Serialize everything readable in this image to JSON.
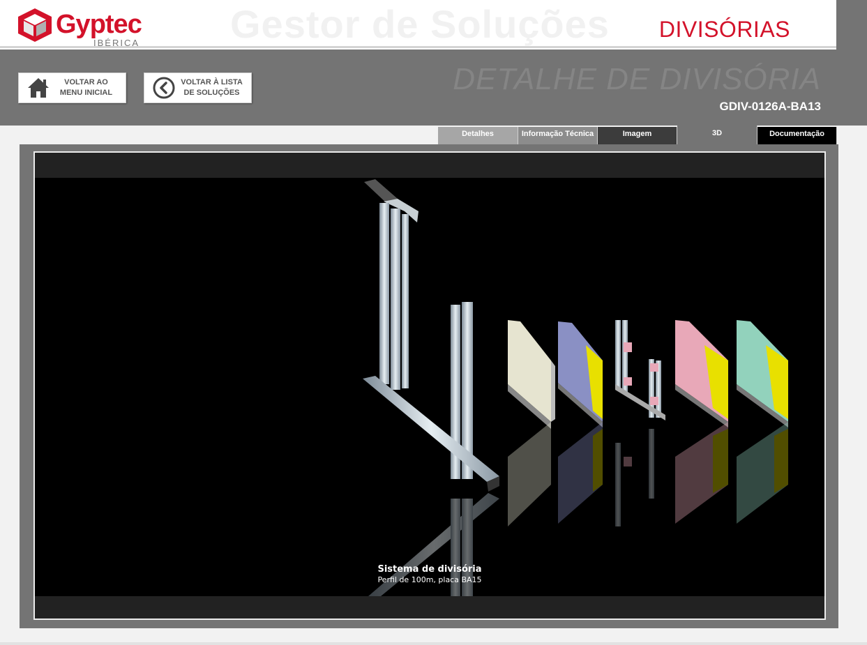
{
  "header": {
    "logo_word_1": "Gyp",
    "logo_word_2": "tec",
    "logo_sub": "IBÉRICA",
    "app_title": "Gestor de Soluções",
    "section_title": "DIVISÓRIAS"
  },
  "nav": {
    "home_line1": "VOLTAR AO",
    "home_line2": "MENU INICIAL",
    "back_line1": "VOLTAR À LISTA",
    "back_line2": "DE SOLUÇÕES"
  },
  "detail": {
    "title": "DETALHE DE DIVISÓRIA",
    "code": "GDIV-0126A-BA13"
  },
  "tabs": [
    {
      "label": "Detalhes"
    },
    {
      "label": "Informação Técnica"
    },
    {
      "label": "Imagem"
    },
    {
      "label": "3D",
      "active": true
    },
    {
      "label": "Documentação"
    }
  ],
  "viewer": {
    "caption_title": "Sistema de divisória",
    "caption_subtitle": "Perfil de 100m, placa BA15"
  },
  "colors": {
    "brand_red": "#d3122a",
    "band_gray": "#747474",
    "panel_colors": [
      "#e6e4d0",
      "#8a90c4",
      "#d8d8d8",
      "#e8a8b8",
      "#92d2bc"
    ],
    "insulation": "#e8e000"
  }
}
